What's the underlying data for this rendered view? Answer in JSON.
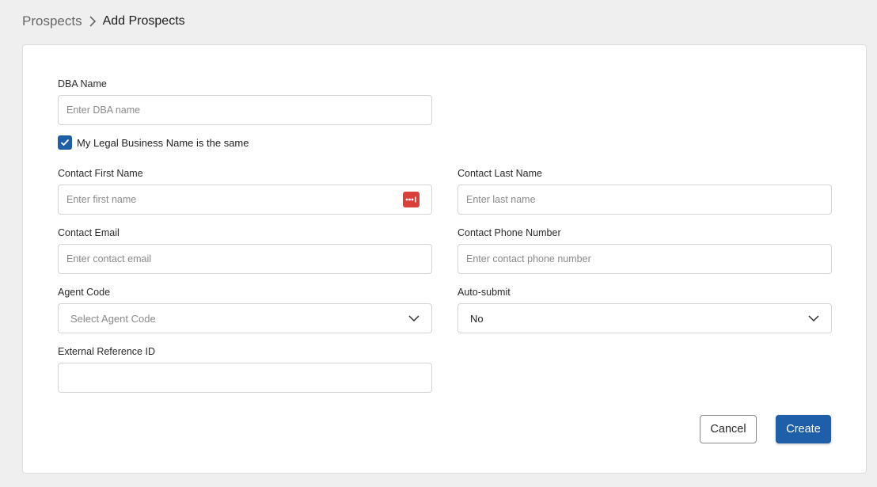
{
  "breadcrumb": {
    "root": "Prospects",
    "current": "Add Prospects"
  },
  "form": {
    "dba_name": {
      "label": "DBA Name",
      "placeholder": "Enter DBA name",
      "value": ""
    },
    "legal_same": {
      "label": "My Legal Business Name is the same",
      "checked": true
    },
    "first_name": {
      "label": "Contact First Name",
      "placeholder": "Enter first name",
      "value": ""
    },
    "last_name": {
      "label": "Contact Last Name",
      "placeholder": "Enter last name",
      "value": ""
    },
    "email": {
      "label": "Contact Email",
      "placeholder": "Enter contact email",
      "value": ""
    },
    "phone": {
      "label": "Contact Phone Number",
      "placeholder": "Enter contact phone number",
      "value": ""
    },
    "agent_code": {
      "label": "Agent Code",
      "placeholder": "Select Agent Code"
    },
    "auto_submit": {
      "label": "Auto-submit",
      "value": "No"
    },
    "external_ref": {
      "label": "External Reference ID",
      "placeholder": "",
      "value": ""
    }
  },
  "actions": {
    "cancel_label": "Cancel",
    "create_label": "Create"
  },
  "icons": {
    "breadcrumb_separator": "chevron-right-icon",
    "select_arrow": "chevron-down-icon",
    "checkbox_mark": "checkmark-icon",
    "password_manager": "password-manager-icon"
  },
  "colors": {
    "primary": "#1f5ea8",
    "password_manager": "#d9403a",
    "page_bg": "#efefef"
  }
}
